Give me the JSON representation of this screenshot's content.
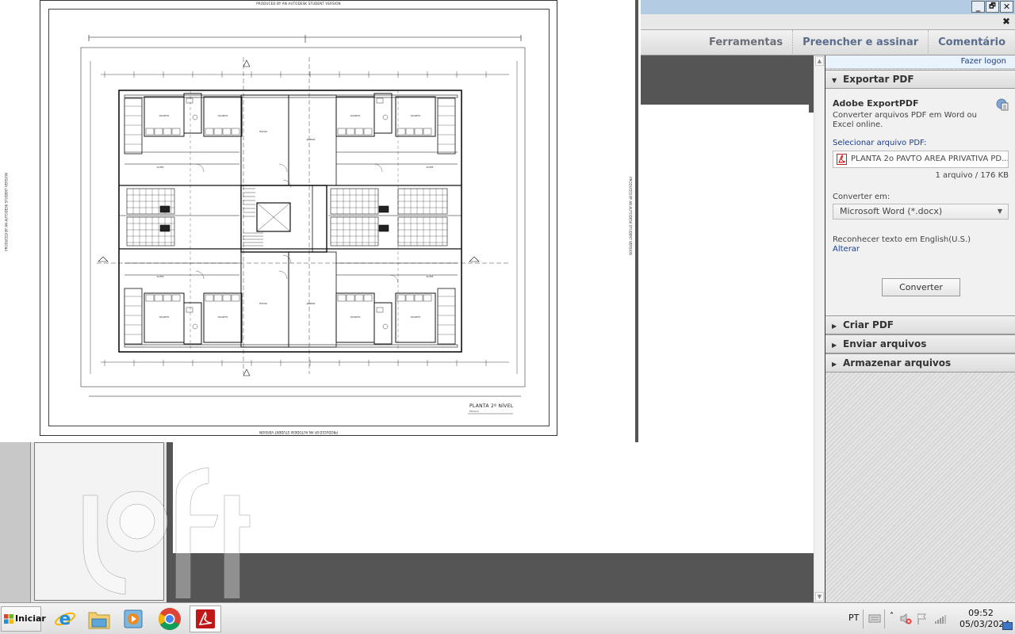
{
  "document": {
    "watermark": "PRODUCED BY AN AUTODESK STUDENT VERSION",
    "plan_title": "PLANTA 2º NÍVEL",
    "plan_subtitle": "ESCALA",
    "room_labels": [
      "QUARTO",
      "QUARTO",
      "QUARTO",
      "QUARTO",
      "QUARTO",
      "QUARTO",
      "QUARTO",
      "QUARTO",
      "SUÍTE",
      "SUÍTE",
      "SUÍTE",
      "SUÍTE",
      "ESTAR",
      "ESTAR",
      "ESTAR",
      "ESTAR",
      "BWC",
      "BWC",
      "CIRC.",
      "CIRC."
    ]
  },
  "window": {
    "controls": {
      "minimize": "_",
      "restore": "🗗",
      "close": "✕"
    },
    "panel_close": "✖"
  },
  "tabs": [
    {
      "label": "Ferramentas"
    },
    {
      "label": "Preencher e assinar"
    },
    {
      "label": "Comentário"
    }
  ],
  "panel": {
    "logon_link": "Fazer logon",
    "export_pdf": {
      "header": "Exportar PDF",
      "expanded": true,
      "title": "Adobe ExportPDF",
      "description": "Converter arquivos PDF em Word ou Excel online.",
      "select_label": "Selecionar arquivo PDF:",
      "file_name": "PLANTA 2o PAVTO AREA PRIVATIVA PD...",
      "file_info": "1 arquivo / 176 KB",
      "convert_to_label": "Converter em:",
      "convert_to_value": "Microsoft Word (*.docx)",
      "ocr_text": "Reconhecer texto em English(U.S.)",
      "ocr_change_link": "Alterar",
      "convert_button": "Converter"
    },
    "sections": [
      {
        "label": "Criar PDF",
        "expanded": false
      },
      {
        "label": "Enviar arquivos",
        "expanded": false
      },
      {
        "label": "Armazenar arquivos",
        "expanded": false
      }
    ]
  },
  "taskbar": {
    "start_label": "Iniciar",
    "apps": [
      {
        "name": "Internet Explorer"
      },
      {
        "name": "Windows Explorer"
      },
      {
        "name": "Windows Media Player"
      },
      {
        "name": "Google Chrome"
      },
      {
        "name": "Adobe Reader",
        "active": true
      }
    ],
    "language": "PT",
    "time": "09:52",
    "date": "05/03/2024"
  },
  "overlay": {
    "logo_text": "loft"
  },
  "colors": {
    "titlebar": "#b3cbe3",
    "link": "#1a3e8a",
    "dark_background": "#555555",
    "tab_text": "#6b6f7a"
  }
}
